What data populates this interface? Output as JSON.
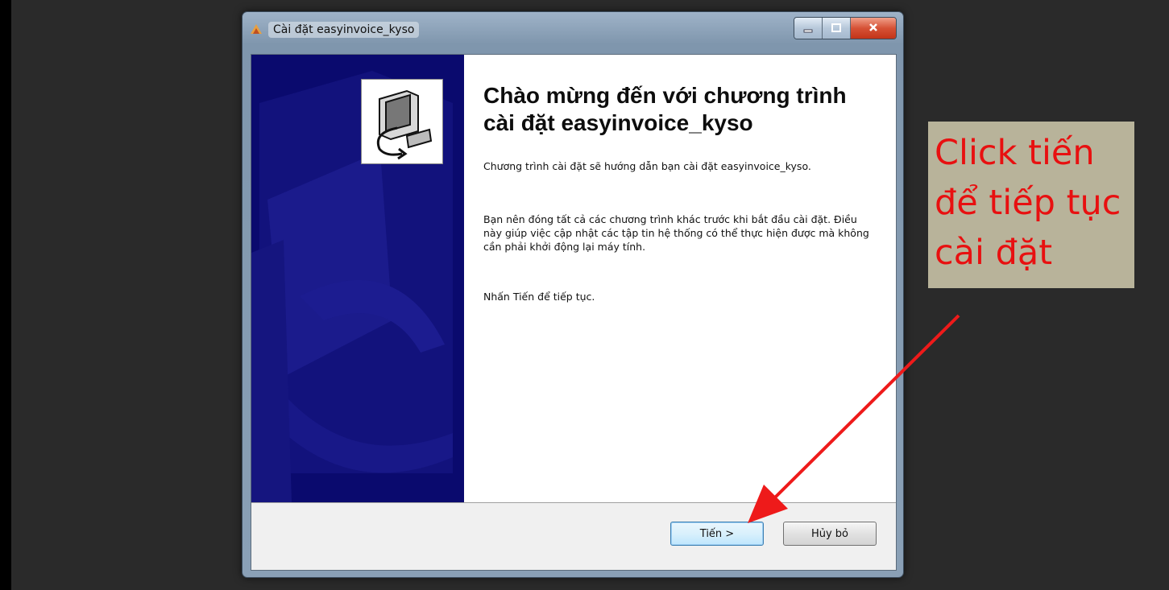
{
  "window": {
    "title": "Cài đặt easyinvoice_kyso",
    "app_icon": "installer-app-icon",
    "controls": {
      "minimize_icon": "minimize-icon",
      "maximize_icon": "maximize-icon",
      "close_icon": "close-icon"
    }
  },
  "banner": {
    "logo_icon": "computer-install-icon",
    "color": "#0a0a6e"
  },
  "content": {
    "heading": "Chào mừng đến với chương trình cài đặt easyinvoice_kyso",
    "paragraph1": "Chương trình cài đặt sẽ hướng dẫn bạn cài đặt easyinvoice_kyso.",
    "paragraph2": "Bạn nên đóng tất cả các chương trình khác trước khi bắt đầu cài đặt. Điều này giúp việc cập nhật các tập tin hệ thống có thể thực hiện được mà không cần phải khởi động lại máy tính.",
    "paragraph3": "Nhấn Tiến để tiếp tục."
  },
  "buttons": {
    "next_label": "Tiến >",
    "cancel_label": "Hủy bỏ"
  },
  "annotation": {
    "text": "Click tiến\nđể tiếp tục\ncài đặt",
    "text_color": "#e81010",
    "background": "#b8b39a",
    "arrow_icon": "red-arrow-icon"
  }
}
